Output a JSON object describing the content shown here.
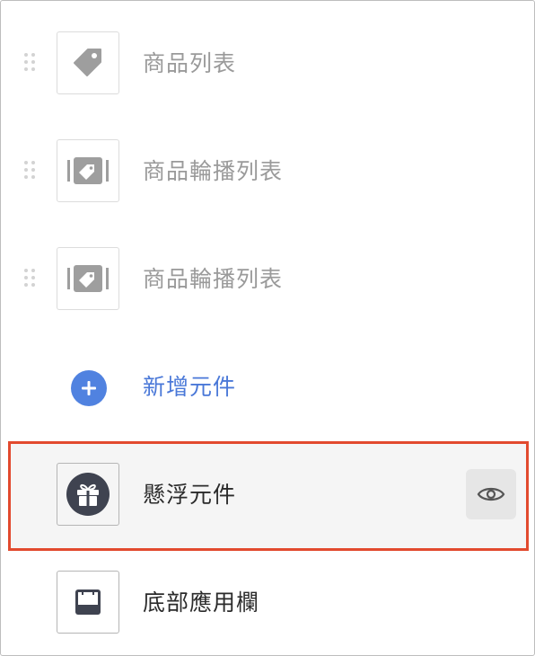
{
  "components": {
    "items": [
      {
        "label": "商品列表",
        "icon": "tag-icon",
        "state": "disabled"
      },
      {
        "label": "商品輪播列表",
        "icon": "tag-carousel-icon",
        "state": "disabled"
      },
      {
        "label": "商品輪播列表",
        "icon": "tag-carousel-icon",
        "state": "disabled"
      }
    ],
    "add_label": "新增元件",
    "floating": {
      "label": "懸浮元件",
      "icon": "gift-icon",
      "action_icon": "eye-icon"
    },
    "footer": {
      "label": "底部應用欄",
      "icon": "bottom-bar-icon"
    }
  },
  "colors": {
    "accent_blue": "#5082e0",
    "highlight_border": "#e24a2e",
    "muted_text": "#9a9a9a"
  }
}
